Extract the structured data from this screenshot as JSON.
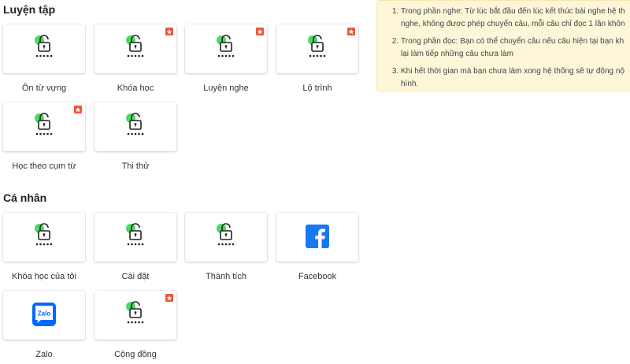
{
  "practice": {
    "title": "Luyện tập",
    "tiles": [
      {
        "label": "Ôn từ vựng",
        "icon": "lock-icon",
        "badge": false
      },
      {
        "label": "Khóa học",
        "icon": "lock-icon",
        "badge": true
      },
      {
        "label": "Luyện nghe",
        "icon": "lock-icon",
        "badge": true
      },
      {
        "label": "Lộ trình",
        "icon": "lock-icon",
        "badge": true
      },
      {
        "label": "Học theo cụm từ",
        "icon": "lock-icon",
        "badge": true
      },
      {
        "label": "Thi thử",
        "icon": "lock-icon",
        "badge": false
      }
    ]
  },
  "personal": {
    "title": "Cá nhân",
    "tiles": [
      {
        "label": "Khóa học của tôi",
        "icon": "lock-icon",
        "badge": false
      },
      {
        "label": "Cài đặt",
        "icon": "lock-icon",
        "badge": false
      },
      {
        "label": "Thành tích",
        "icon": "lock-icon",
        "badge": false
      },
      {
        "label": "Facebook",
        "icon": "facebook-icon",
        "badge": false
      },
      {
        "label": "Zalo",
        "icon": "zalo-icon",
        "badge": false,
        "icon_text": "Zalo"
      },
      {
        "label": "Cộng đồng",
        "icon": "lock-icon",
        "badge": true
      }
    ]
  },
  "notice": {
    "items": [
      {
        "line1": "Trong phần nghe: Từ lúc bắt đầu đến lúc kết thúc bài nghe hệ th",
        "line2": "nghe, không được phép chuyển câu, mỗi câu chỉ đọc 1 lần khôn"
      },
      {
        "line1": "Trong phần đọc: Bạn có thể chuyển câu nếu câu hiện tại bạn kh",
        "line2": "lại làm tiếp những câu chưa làm"
      },
      {
        "line1": "Khi hết thời gian mà bạn chưa làm xong hệ thống sẽ tự động nộ",
        "line2": "hình."
      }
    ]
  },
  "colors": {
    "badge": "#e9573e",
    "lock_accent": "#4cd964",
    "facebook": "#1877f2",
    "zalo": "#0068ff",
    "notice_bg": "#fdf6d9"
  }
}
